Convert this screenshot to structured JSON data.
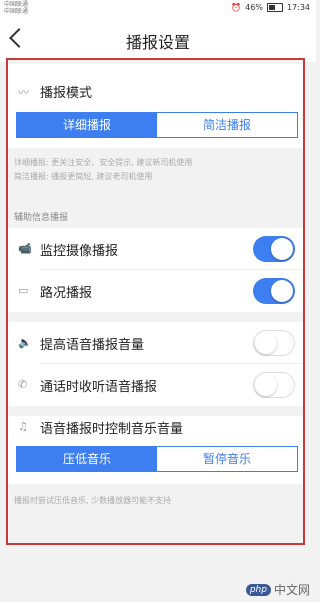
{
  "status": {
    "carrier1": "中国联通",
    "carrier2": "中国联通",
    "battery": "46%",
    "time": "17:34"
  },
  "header": {
    "title": "播报设置"
  },
  "broadcast_mode": {
    "label": "播报模式",
    "options": [
      "详细播报",
      "简洁播报"
    ],
    "selected": "详细播报"
  },
  "mode_notes": [
    "详细播报: 更关注安全、安全提示, 建议新司机使用",
    "简洁播报: 播报更简短, 建议老司机使用"
  ],
  "aux": {
    "group_label": "辅助信息播报",
    "items": [
      {
        "label": "监控摄像播报",
        "on": true,
        "icon": "camera-icon"
      },
      {
        "label": "路况播报",
        "on": true,
        "icon": "traffic-icon"
      }
    ]
  },
  "voice": {
    "items": [
      {
        "label": "提高语音播报音量",
        "on": false,
        "icon": "speaker-icon"
      },
      {
        "label": "通话时收听语音播报",
        "on": false,
        "icon": "phone-icon"
      }
    ]
  },
  "music": {
    "label": "语音播报时控制音乐音量",
    "options": [
      "压低音乐",
      "暂停音乐"
    ],
    "selected": "压低音乐",
    "icon": "music-icon"
  },
  "music_note": "播报时尝试压低音乐, 少数播放器可能不支持",
  "watermark": {
    "logo": "php",
    "text": "中文网"
  },
  "colors": {
    "accent": "#3d7ef0",
    "frame": "#c23a3a"
  }
}
